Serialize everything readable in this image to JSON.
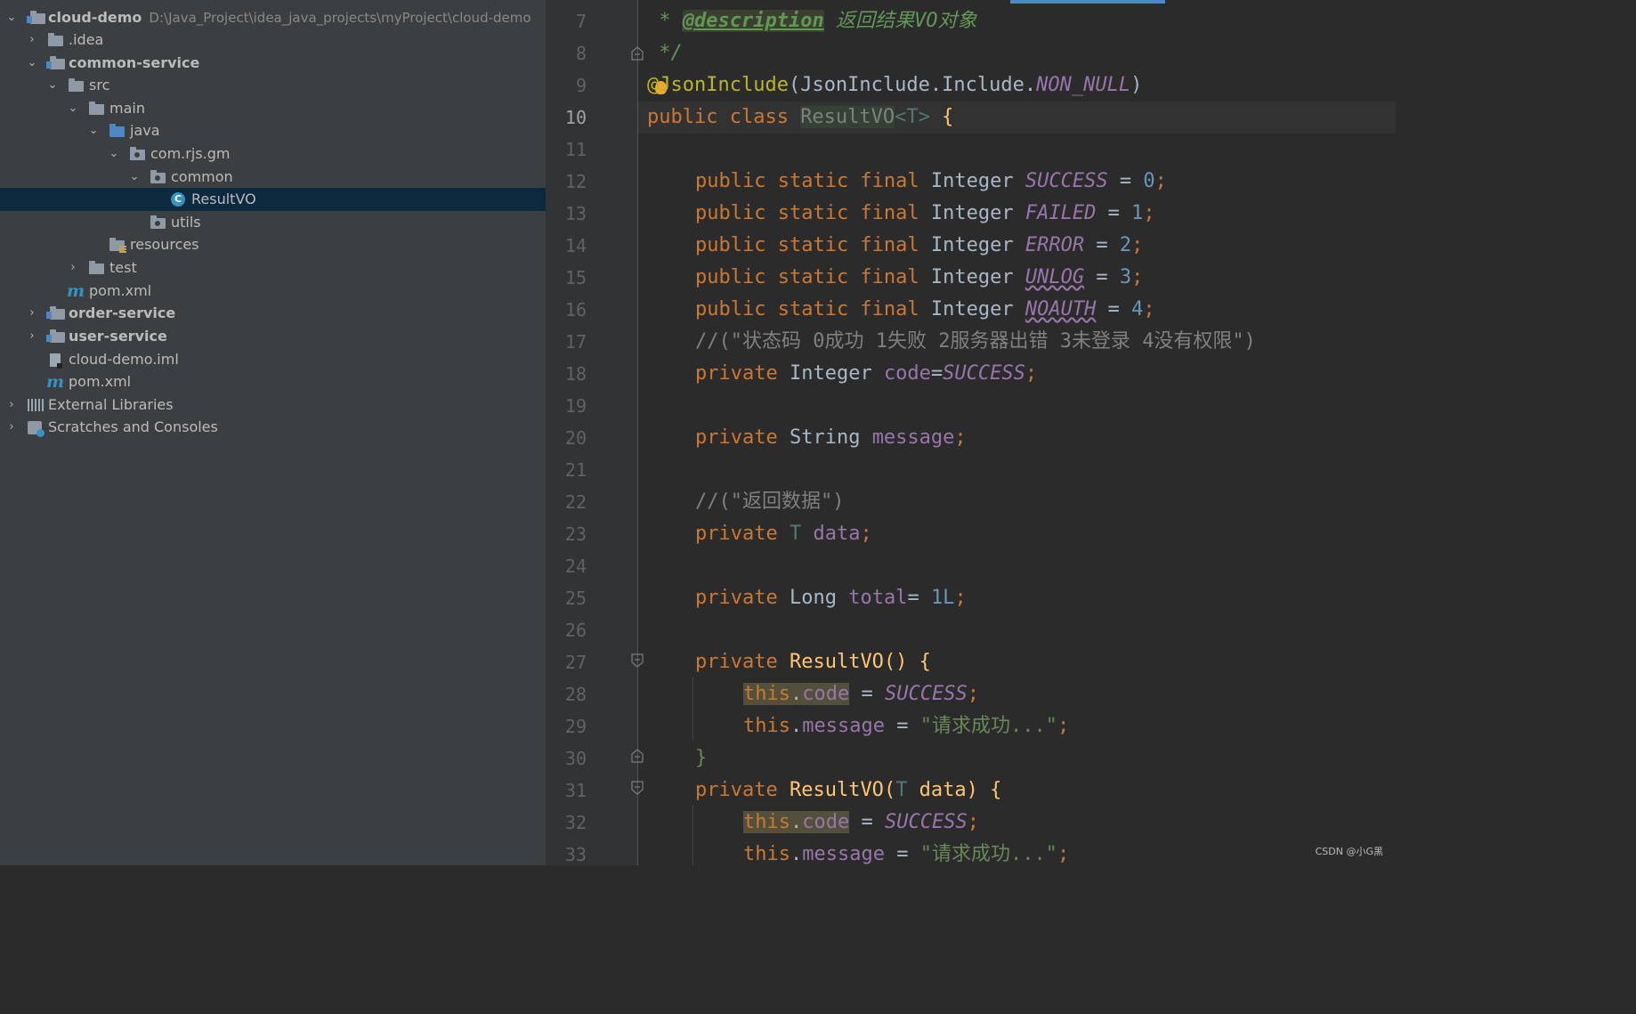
{
  "project_tree": {
    "root_name": "cloud-demo",
    "root_path": "D:\\Java_Project\\idea_java_projects\\myProject\\cloud-demo",
    "items": [
      {
        "label": ".idea"
      },
      {
        "label": "common-service"
      },
      {
        "label": "src"
      },
      {
        "label": "main"
      },
      {
        "label": "java"
      },
      {
        "label": "com.rjs.gm"
      },
      {
        "label": "common"
      },
      {
        "label": "ResultVO"
      },
      {
        "label": "utils"
      },
      {
        "label": "resources"
      },
      {
        "label": "test"
      },
      {
        "label": "pom.xml"
      },
      {
        "label": "order-service"
      },
      {
        "label": "user-service"
      },
      {
        "label": "cloud-demo.iml"
      },
      {
        "label": "pom.xml"
      },
      {
        "label": "External Libraries"
      },
      {
        "label": "Scratches and Consoles"
      }
    ],
    "selected": "ResultVO"
  },
  "editor": {
    "current_line": "10",
    "line_numbers": [
      "7",
      "8",
      "9",
      "10",
      "11",
      "12",
      "13",
      "14",
      "15",
      "16",
      "17",
      "18",
      "19",
      "20",
      "21",
      "22",
      "23",
      "24",
      "25",
      "26",
      "27",
      "28",
      "29",
      "30",
      "31",
      "32",
      "33"
    ],
    "tokens": {
      "l7_star": " * ",
      "l7_tag": "@description",
      "l7_text": " 返回结果VO对象",
      "l8": " */",
      "l9_at": "@",
      "l9_a": "JsonInclude",
      "l9_b": "(JsonInclude.Include.",
      "l9_c": "NON_NULL",
      "l9_d": ")",
      "l10_kw": "public class ",
      "l10_name": "ResultVO",
      "l10_tp": "<T>",
      "l10_br": " {",
      "kw_psf": "public static final ",
      "type_integer": "Integer ",
      "f_success": "SUCCESS",
      "f_failed": "FAILED",
      "f_error": "ERROR",
      "f_unlog": "UNLOG",
      "f_noauth": "NOAUTH",
      "eq": " = ",
      "v0": "0",
      "v1": "1",
      "v2": "2",
      "v3": "3",
      "v4": "4",
      "semi": ";",
      "l17": "//(\"状态码 0成功 1失败 2服务器出错 3未登录 4没有权限\")",
      "kw_private": "private ",
      "f_code": "code",
      "l18_eq": "=",
      "type_string": "String ",
      "f_message": "message",
      "l22": "//(\"返回数据\")",
      "tp_T": "T ",
      "f_data": "data",
      "type_long": "Long ",
      "f_total": "total",
      "l25_eq": "= ",
      "l25_v": "1L",
      "ctor": "ResultVO",
      "ctor_empty": "() {",
      "this_kw": "this",
      "dot": ".",
      "str_ok": "\"请求成功...\"",
      "close": "}",
      "l31_open": "(",
      "l31_T": "T",
      "l31_p": " data) {"
    }
  },
  "watermark": "CSDN @小G黑",
  "colors": {
    "tree_bg": "#3c3f41",
    "editor_bg": "#2b2b2b",
    "keyword": "#cc7832",
    "field": "#9876aa",
    "number": "#6897bb",
    "string": "#6a8759",
    "selection": "#0d293e"
  }
}
